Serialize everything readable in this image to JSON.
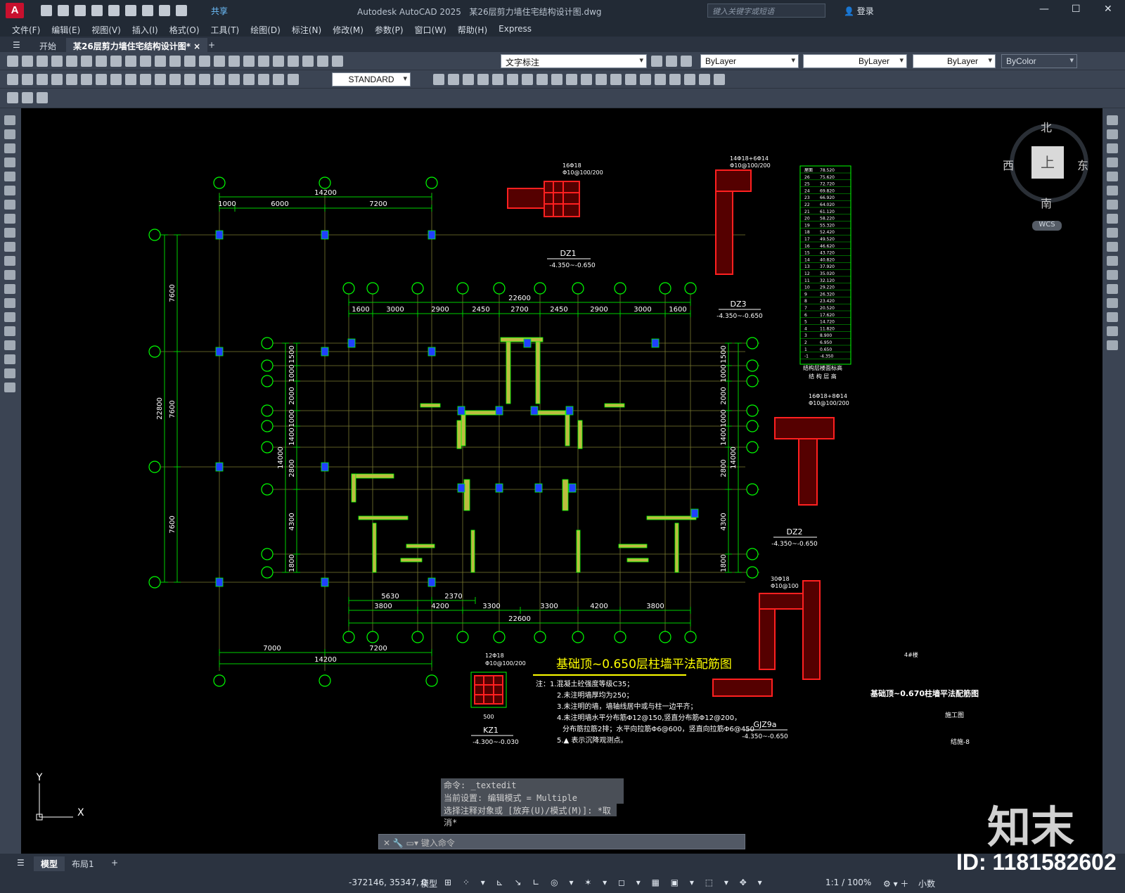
{
  "app": {
    "title": "Autodesk AutoCAD 2025",
    "document": "某26层剪力墙住宅结构设计图.dwg",
    "logo": "A",
    "share": "共享",
    "search_placeholder": "键入关键字或短语",
    "login": "登录"
  },
  "menu": [
    "文件(F)",
    "编辑(E)",
    "视图(V)",
    "插入(I)",
    "格式(O)",
    "工具(T)",
    "绘图(D)",
    "标注(N)",
    "修改(M)",
    "参数(P)",
    "窗口(W)",
    "帮助(H)",
    "Express"
  ],
  "tabs": {
    "start": "开始",
    "drawing": "某26层剪力墙住宅结构设计图*",
    "close": "×",
    "add": "+"
  },
  "toolbar": {
    "layer": "文字标注",
    "dimstyle": "STANDARD",
    "color": "ByLayer",
    "linetype": "ByLayer",
    "lineweight": "ByLayer",
    "plotstyle": "ByColor"
  },
  "viewcube": {
    "north": "北",
    "south": "南",
    "east": "东",
    "west": "西",
    "top": "上",
    "wcs": "WCS"
  },
  "drawing": {
    "axes_top": [
      "1000",
      "6000",
      "7200"
    ],
    "total_top": "14200",
    "axes_inner_top": [
      "1600",
      "3000",
      "2900",
      "2450",
      "2700",
      "2450",
      "2900",
      "3000",
      "1600"
    ],
    "inner_total": "22600",
    "axes_inner_bottom": [
      "3800",
      "4200",
      "3300",
      "3300",
      "4200",
      "3800"
    ],
    "bottom_left": [
      "5630",
      "2370"
    ],
    "bottom_total": "14200",
    "bottom_axes": [
      "7000",
      "7200"
    ],
    "left_dims": [
      "7600",
      "7600",
      "7600"
    ],
    "left_total": "22800",
    "inner_left_dims": [
      "1500",
      "1000",
      "2000",
      "1000",
      "1400",
      "2800",
      "4300",
      "1800"
    ],
    "inner_left_total": "14000",
    "main_title": "基础顶~0.650层柱墙平法配筋图",
    "notes": [
      "注：1.混凝土砼强度等级C35；",
      "2.未注明墙厚均为250；",
      "3.未注明的墙，墙轴线居中或与柱一边平齐；",
      "4.未注明墙水平分布筋Φ12@150,竖直分布筋Φ12@200，",
      "分布筋拉筋2排；水平向拉筋Φ6@600，竖直向拉筋Φ6@450",
      "5.▲ 表示沉降观测点。"
    ],
    "kz1": {
      "label": "KZ1",
      "range": "-4.300~-0.030",
      "rebar": "12Φ18",
      "stir": "Φ10@100/200",
      "dim": "500"
    },
    "dz1": {
      "label": "DZ1",
      "range": "-4.350~-0.650",
      "rebar": "16Φ18",
      "stir": "Φ10@100/200"
    },
    "dz3": {
      "label": "DZ3",
      "range": "-4.350~-0.650",
      "rebar": "14Φ18+6Φ14",
      "stir": "Φ10@100/200"
    },
    "dz2": {
      "label": "DZ2",
      "range": "-4.350~-0.650",
      "rebar": "16Φ18+8Φ14",
      "stir": "Φ10@100/200"
    },
    "gjz9a": {
      "label": "GJZ9a",
      "range": "-4.350~-0.650",
      "rebar": "30Φ18",
      "stir": "Φ10@100"
    },
    "sheet_title": "基础顶~0.670柱墙平法配筋图",
    "sheet_phase": "施工图",
    "sheet_no": "结施-8",
    "floor_table_title": "结构层楼面标高",
    "floor_table_sub": "结 构 层 高",
    "building": "4#楼",
    "levels": [
      "78.520",
      "75.620",
      "72.720",
      "69.820",
      "66.920",
      "64.020",
      "61.120",
      "58.220",
      "55.320",
      "52.420",
      "49.520",
      "46.620",
      "43.720",
      "40.820",
      "37.920",
      "35.020",
      "32.120",
      "29.220",
      "26.320",
      "23.420",
      "20.520",
      "17.620",
      "14.720",
      "11.820",
      "8.900",
      "6.950",
      "0.650",
      "-4.350"
    ],
    "floors": [
      "屋面",
      "26",
      "25",
      "24",
      "23",
      "22",
      "21",
      "20",
      "19",
      "18",
      "17",
      "16",
      "15",
      "14",
      "13",
      "12",
      "11",
      "10",
      "9",
      "8",
      "7",
      "6",
      "5",
      "4",
      "3",
      "2",
      "1",
      "-1"
    ]
  },
  "command": {
    "line1": "命令: _textedit",
    "line2": "当前设置: 编辑模式 = Multiple",
    "line3": "选择注释对象或 [放弃(U)/模式(M)]: *取消*",
    "placeholder": "键入命令"
  },
  "layout_tabs": [
    "模型",
    "布局1"
  ],
  "status": {
    "coord": "-372146, 35347, 0",
    "model": "模型",
    "scale": "1:1 / 100%",
    "units": "小数"
  },
  "watermark": {
    "logo": "知末",
    "id": "ID: 1181582602"
  }
}
